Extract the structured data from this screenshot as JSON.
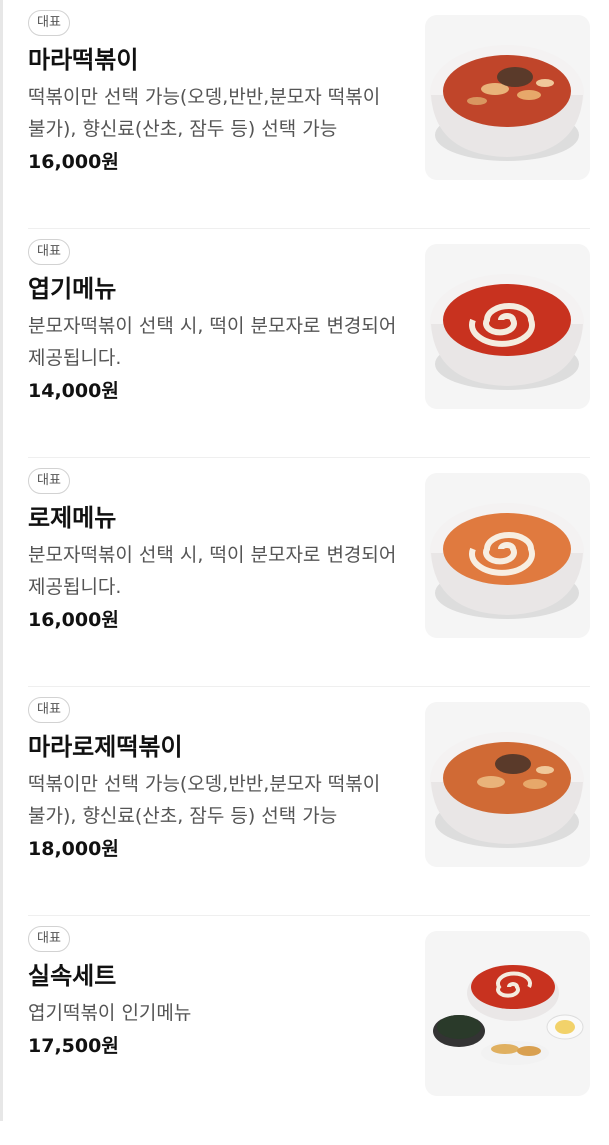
{
  "menu": {
    "items": [
      {
        "badge": "대표",
        "name": "마라떡볶이",
        "desc": "떡볶이만 선택 가능(오뎅,반반,분모자 떡볶이 불가), 향신료(산초, 잠두 등) 선택 가능",
        "price": "16,000원",
        "image": "mala-tteokbokki-bowl-photo",
        "sauce_color": "#c0452a"
      },
      {
        "badge": "대표",
        "name": "엽기메뉴",
        "desc": "분모자떡볶이 선택 시, 떡이 분모자로 변경되어 제공됩니다.",
        "price": "14,000원",
        "image": "yeopgi-tteokbokki-bowl-photo",
        "sauce_color": "#c8321f"
      },
      {
        "badge": "대표",
        "name": "로제메뉴",
        "desc": "분모자떡볶이 선택 시, 떡이 분모자로 변경되어 제공됩니다.",
        "price": "16,000원",
        "image": "rose-tteokbokki-bowl-photo",
        "sauce_color": "#e07a3f"
      },
      {
        "badge": "대표",
        "name": "마라로제떡볶이",
        "desc": "떡볶이만 선택 가능(오뎅,반반,분모자 떡볶이 불가), 향신료(산초, 잠두 등) 선택 가능",
        "price": "18,000원",
        "image": "mala-rose-tteokbokki-bowl-photo",
        "sauce_color": "#d06a35"
      },
      {
        "badge": "대표",
        "name": "실속세트",
        "desc": "엽기떡볶이 인기메뉴",
        "price": "17,500원",
        "image": "value-set-photo",
        "sauce_color": "#c8321f"
      }
    ]
  }
}
